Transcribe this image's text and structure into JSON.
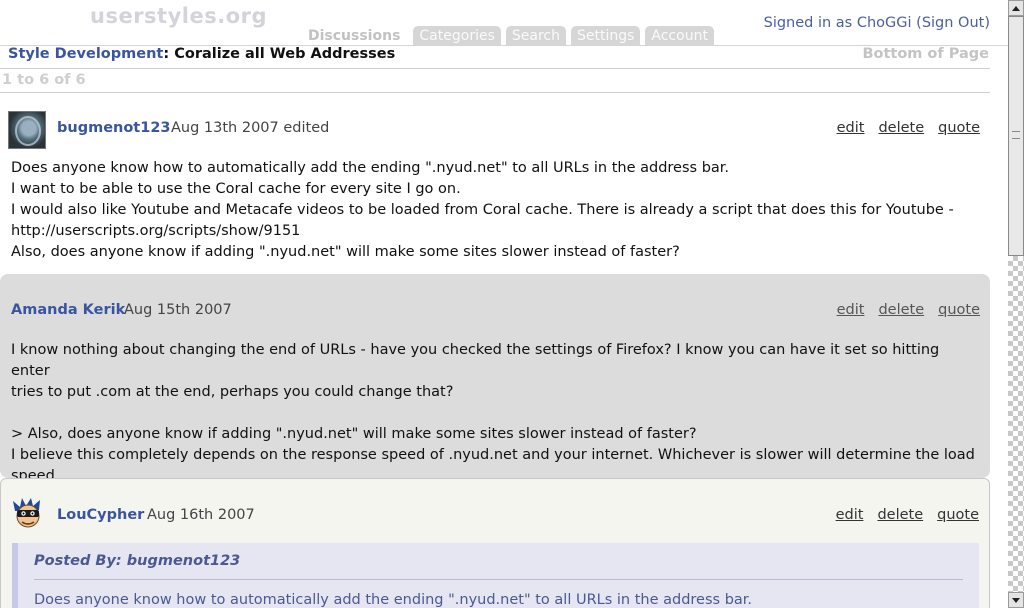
{
  "header": {
    "logo": "userstyles.org",
    "signin_prefix": "Signed in as ",
    "username": "ChoGGi",
    "signout": "(Sign Out)",
    "tabs": [
      "Discussions",
      "Categories",
      "Search",
      "Settings",
      "Account"
    ],
    "active_tab": "Discussions"
  },
  "thread": {
    "section": "Style Development",
    "separator": ": ",
    "title": "Coralize all Web Addresses",
    "bottom_link": "Bottom of Page",
    "count": "1 to 6 of 6"
  },
  "actions": {
    "edit": "edit",
    "delete": "delete",
    "quote": "quote"
  },
  "posts": [
    {
      "author": "bugmenot123",
      "date": "Aug 13th 2007",
      "edited": "edited",
      "lines": [
        "Does anyone know how to automatically add the ending \".nyud.net\" to all URLs in the address bar.",
        "I want to be able to use the Coral cache for every site I go on.",
        "I would also like Youtube and Metacafe videos to be loaded from Coral cache. There is already a script that does this for Youtube -",
        "http://userscripts.org/scripts/show/9151",
        "Also, does anyone know if adding \".nyud.net\" will make some sites slower instead of faster?"
      ]
    },
    {
      "author": "Amanda Kerik",
      "date": "Aug 15th 2007",
      "lines": [
        "I know nothing about changing the end of URLs - have you checked the settings of Firefox? I know you can have it set so hitting enter",
        "tries to put .com at the end, perhaps you could change that?",
        "> Also, does anyone know if adding \".nyud.net\" will make some sites slower instead of faster?",
        "I believe this completely depends on the response speed of .nyud.net and your internet. Whichever is slower will determine the load",
        "speed."
      ]
    },
    {
      "author": "LouCypher",
      "date": "Aug 16th 2007",
      "quote_header": "Posted By: bugmenot123",
      "quote_text": "Does anyone know how to automatically add the ending \".nyud.net\" to all URLs in the address bar."
    }
  ],
  "icons": {
    "avatar_1": "avatar-image",
    "avatar_3": "ninja-avatar",
    "scroll_up": "chevron-up-icon",
    "scroll_down": "chevron-down-icon"
  }
}
